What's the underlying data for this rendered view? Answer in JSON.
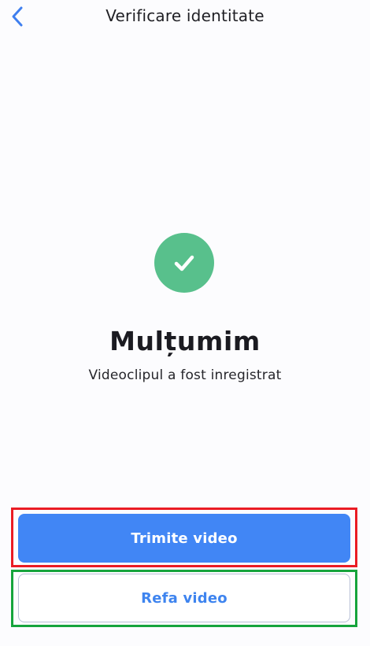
{
  "header": {
    "title": "Verificare identitate",
    "back_icon": "chevron-left-icon"
  },
  "status": {
    "icon": "check-icon",
    "icon_color": "#58c08c",
    "title": "Mulțumim",
    "message": "Videoclipul a fost inregistrat"
  },
  "actions": {
    "primary_label": "Trimite video",
    "secondary_label": "Refa video",
    "primary_color": "#4186f5",
    "secondary_text_color": "#3e84ef"
  },
  "highlights": {
    "primary_color": "#ea1c24",
    "secondary_color": "#16a43c"
  }
}
